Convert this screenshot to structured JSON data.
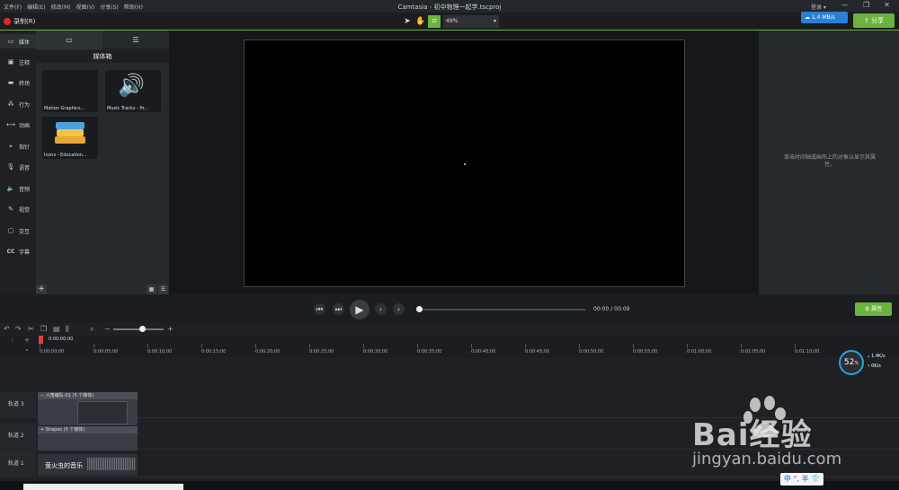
{
  "menu": [
    "文件(F)",
    "编辑(E)",
    "修改(M)",
    "视图(V)",
    "分享(S)",
    "帮助(H)"
  ],
  "window_title": "Camtasia - 初中物理一起学.tscproj",
  "account": {
    "login_label": "登录 ▾"
  },
  "window_controls": [
    "—",
    "❐",
    "✕"
  ],
  "toolbar": {
    "record_label": "录制(R)",
    "zoom_value": "49%",
    "upload_label": "1.4 MB/s",
    "share_label": "分享"
  },
  "sidebar": {
    "items": [
      {
        "label": "媒体",
        "icon": "media-icon"
      },
      {
        "label": "注释",
        "icon": "annotation-icon"
      },
      {
        "label": "转场",
        "icon": "transition-icon"
      },
      {
        "label": "行为",
        "icon": "behavior-icon"
      },
      {
        "label": "动画",
        "icon": "animation-icon"
      },
      {
        "label": "指针",
        "icon": "cursor-icon"
      },
      {
        "label": "语音",
        "icon": "microphone-icon"
      },
      {
        "label": "音频",
        "icon": "audio-icon"
      },
      {
        "label": "视觉",
        "icon": "visual-icon"
      },
      {
        "label": "交互",
        "icon": "interaction-icon"
      },
      {
        "label": "字幕",
        "icon": "captions-icon"
      }
    ]
  },
  "media_bin": {
    "title": "媒体箱",
    "items": [
      {
        "label": "Motion Graphics..."
      },
      {
        "label": "Music Tracks - fir..."
      },
      {
        "label": "Icons - Education..."
      }
    ]
  },
  "properties": {
    "hint": "单击时间轴或画布上的对象以显示其属性。",
    "button_label": "属性"
  },
  "player": {
    "current_time": "00:00",
    "separator": "/",
    "total_time": "00:09"
  },
  "timeline": {
    "playhead_time": "0:00:00;00",
    "ticks": [
      "0:00:00;00",
      "0:00:05;00",
      "0:00:10;00",
      "0:00:15;00",
      "0:00:20;00",
      "0:00:25;00",
      "0:00:30;00",
      "0:00:35;00",
      "0:00:40;00",
      "0:00:45;00",
      "0:00:50;00",
      "0:00:55;00",
      "0:01:00;00",
      "0:01:05;00",
      "0:01:10;00"
    ],
    "tracks": [
      {
        "label": "轨道 3",
        "clip_header": "− 六角编队-01  (5 个媒体)"
      },
      {
        "label": "轨道 2",
        "clip_header": "+ Shapes  (5 个媒体)"
      },
      {
        "label": "轨道 1",
        "clip_name": "萤火虫的音乐"
      }
    ]
  },
  "system_monitor": {
    "cpu_percent": "52",
    "cpu_unit": "%",
    "up_speed": "1.4K/s",
    "down_speed": "0K/s"
  },
  "watermark": {
    "brand": "Bai经验",
    "url": "jingyan.baidu.com"
  },
  "ime": {
    "label": "中 °, 半 👕"
  }
}
